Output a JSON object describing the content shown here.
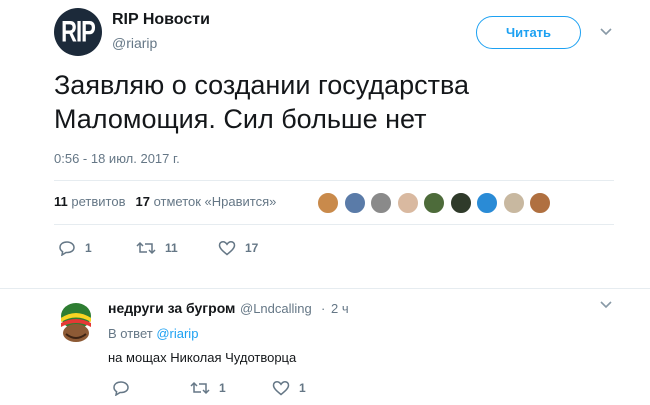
{
  "tweet": {
    "avatar_text": "RIP",
    "author_name": "RIP Новости",
    "author_handle": "@riarip",
    "follow_label": "Читать",
    "text_line1": "Заявляю о создании государства",
    "text_line2": "Маломощия. Сил больше нет",
    "timestamp": "0:56 - 18 июл. 2017 г.",
    "retweets_count": "11",
    "retweets_label": "ретвитов",
    "likes_count": "17",
    "likes_label": "отметок «Нравится»",
    "actions": {
      "reply_count": "1",
      "retweet_count": "11",
      "like_count": "17"
    }
  },
  "likers": [
    {
      "name": "liker-avatar-1",
      "color": "#c98a4b"
    },
    {
      "name": "liker-avatar-2",
      "color": "#5a7ba8"
    },
    {
      "name": "liker-avatar-3",
      "color": "#8a8a8a"
    },
    {
      "name": "liker-avatar-4",
      "color": "#d9b9a0"
    },
    {
      "name": "liker-avatar-5",
      "color": "#4d6b3a"
    },
    {
      "name": "liker-avatar-6",
      "color": "#2f3a2a"
    },
    {
      "name": "liker-avatar-7",
      "color": "#2a8bd6"
    },
    {
      "name": "liker-avatar-8",
      "color": "#c8b8a0"
    },
    {
      "name": "liker-avatar-9",
      "color": "#b07040"
    }
  ],
  "reply": {
    "author_name": "недруги за бугром",
    "author_handle": "@Lndcalling",
    "separator": "·",
    "time": "2 ч",
    "in_reply_prefix": "В ответ",
    "in_reply_handle": "@riarip",
    "text": "на мощах Николая Чудотворца",
    "actions": {
      "retweet_count": "1",
      "like_count": "1"
    }
  },
  "colors": {
    "accent": "#1da1f2",
    "muted": "#657786",
    "text": "#14171a",
    "divider": "#e6ecf0"
  }
}
